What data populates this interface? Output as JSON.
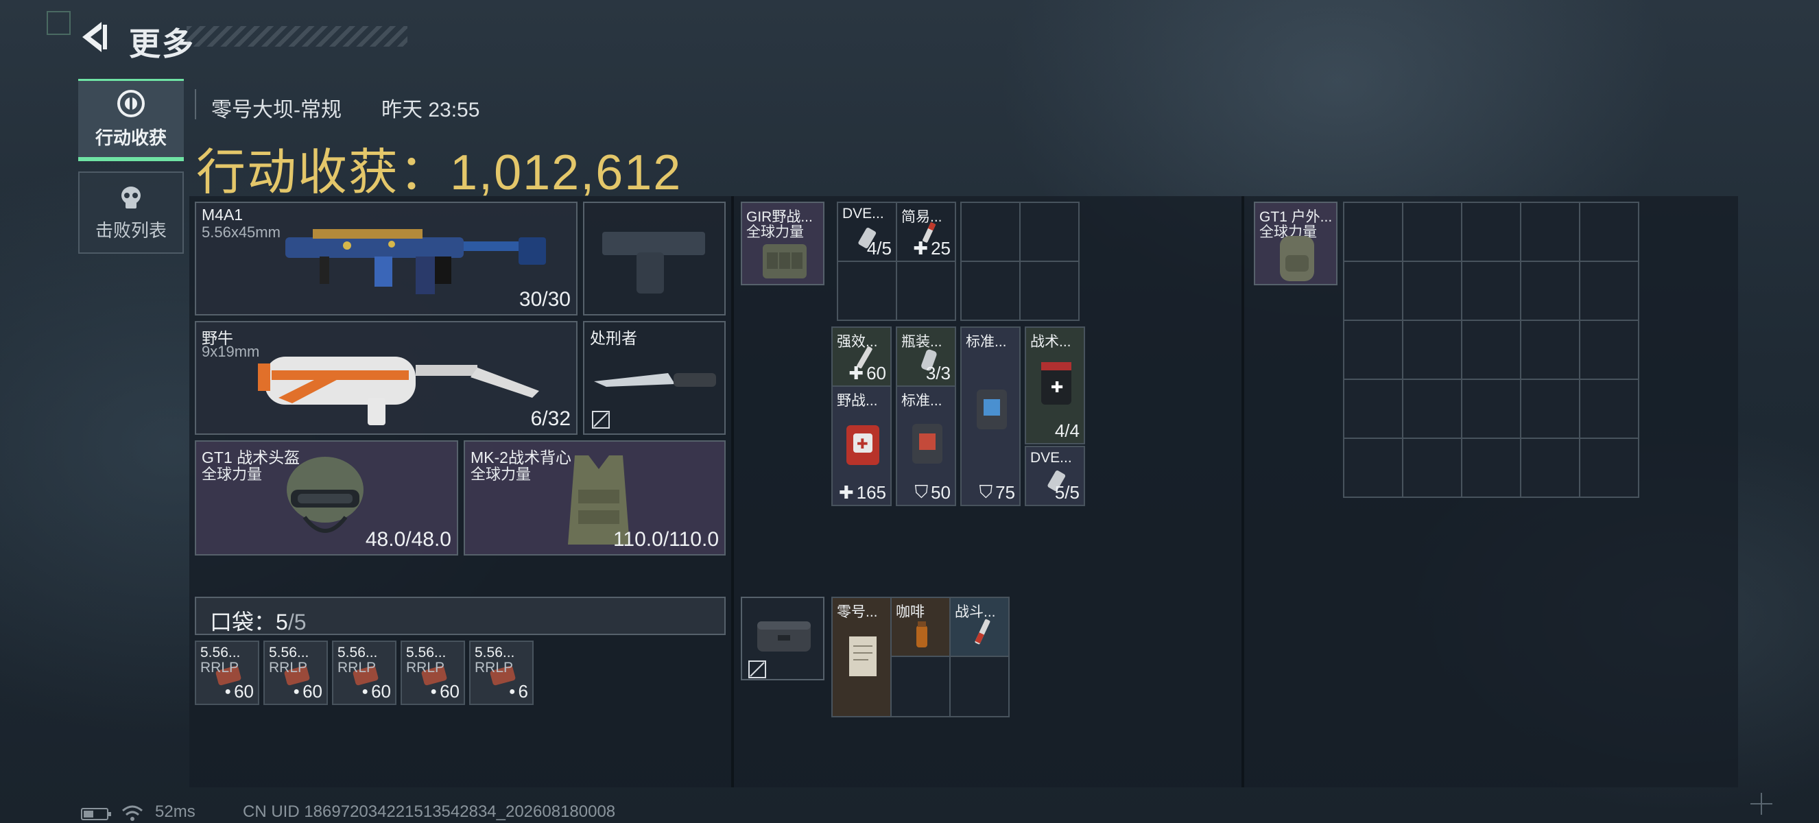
{
  "header": {
    "title": "更多",
    "back_icon": "back-arrow-icon"
  },
  "tabs": [
    {
      "label": "行动收获",
      "icon": "loot-icon",
      "active": true
    },
    {
      "label": "击败列表",
      "icon": "skull-icon",
      "active": false
    }
  ],
  "raid": {
    "map": "零号大坝-常规",
    "time": "昨天 23:55"
  },
  "loot_total": {
    "label": "行动收获：",
    "value": "1,012,612"
  },
  "equipment": {
    "primary": {
      "name": "M4A1",
      "caliber": "5.56x45mm",
      "ammo": "30/30"
    },
    "pistol": {
      "name": ""
    },
    "secondary": {
      "name": "野牛",
      "caliber": "9x19mm",
      "ammo": "6/32"
    },
    "melee": {
      "name": "处刑者"
    },
    "helmet": {
      "name": "GT1 战术头盔",
      "brand": "全球力量",
      "durability": "48.0/48.0"
    },
    "armor": {
      "name": "MK-2战术背心",
      "brand": "全球力量",
      "durability": "110.0/110.0"
    }
  },
  "chest_rig": {
    "name": "GIR野战...",
    "brand": "全球力量"
  },
  "rig_items": [
    {
      "name": "DVE...",
      "value": "4/5"
    },
    {
      "name": "简易...",
      "value": "25"
    }
  ],
  "vest_items": [
    {
      "name": "强效...",
      "value": "60"
    },
    {
      "name": "瓶装...",
      "value": "3/3"
    },
    {
      "name": "标准...",
      "value": ""
    },
    {
      "name": "战术...",
      "value": "4/4"
    },
    {
      "name": "野战...",
      "value": "165"
    },
    {
      "name": "标准...",
      "value": "50"
    },
    {
      "name": "",
      "value": "75"
    },
    {
      "name": "DVE...",
      "value": "5/5"
    }
  ],
  "backpack": {
    "name": "GT1 户外...",
    "brand": "全球力量"
  },
  "pocket": {
    "label": "口袋：",
    "count": "5",
    "capacity": "/5"
  },
  "pocket_items": [
    {
      "name": "5.56...",
      "sub": "RRLP",
      "value": "60"
    },
    {
      "name": "5.56...",
      "sub": "RRLP",
      "value": "60"
    },
    {
      "name": "5.56...",
      "sub": "RRLP",
      "value": "60"
    },
    {
      "name": "5.56...",
      "sub": "RRLP",
      "value": "60"
    },
    {
      "name": "5.56...",
      "sub": "RRLP",
      "value": "6"
    }
  ],
  "safe_box_items": [
    {
      "name": "零号..."
    },
    {
      "name": "咖啡"
    },
    {
      "name": "战斗..."
    }
  ],
  "status_bar": {
    "ping": "52ms",
    "uid": "CN UID 18697203422151354283​4_202608180008"
  },
  "colors": {
    "accent": "#6fe3a4",
    "gold": "#e4c76a",
    "panel": "#161e27"
  }
}
